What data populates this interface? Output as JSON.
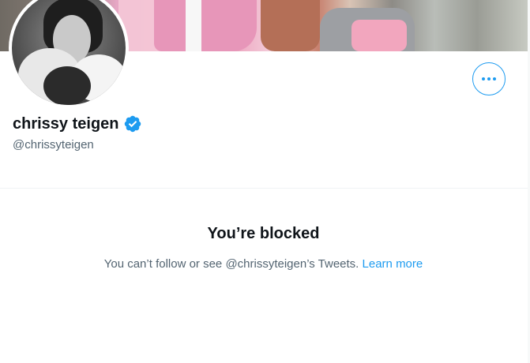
{
  "profile": {
    "display_name": "chrissy teigen",
    "handle": "@chrissyteigen",
    "verified": true,
    "banner_icon": "banner-photo",
    "avatar_icon": "avatar-photo"
  },
  "actions": {
    "more_icon": "more-horizontal-icon"
  },
  "blocked": {
    "title": "You’re blocked",
    "message": "You can’t follow or see @chrissyteigen’s Tweets.",
    "link_label": "Learn more"
  },
  "colors": {
    "accent": "#1d9bf0",
    "text_primary": "#0f1419",
    "text_secondary": "#536471"
  }
}
